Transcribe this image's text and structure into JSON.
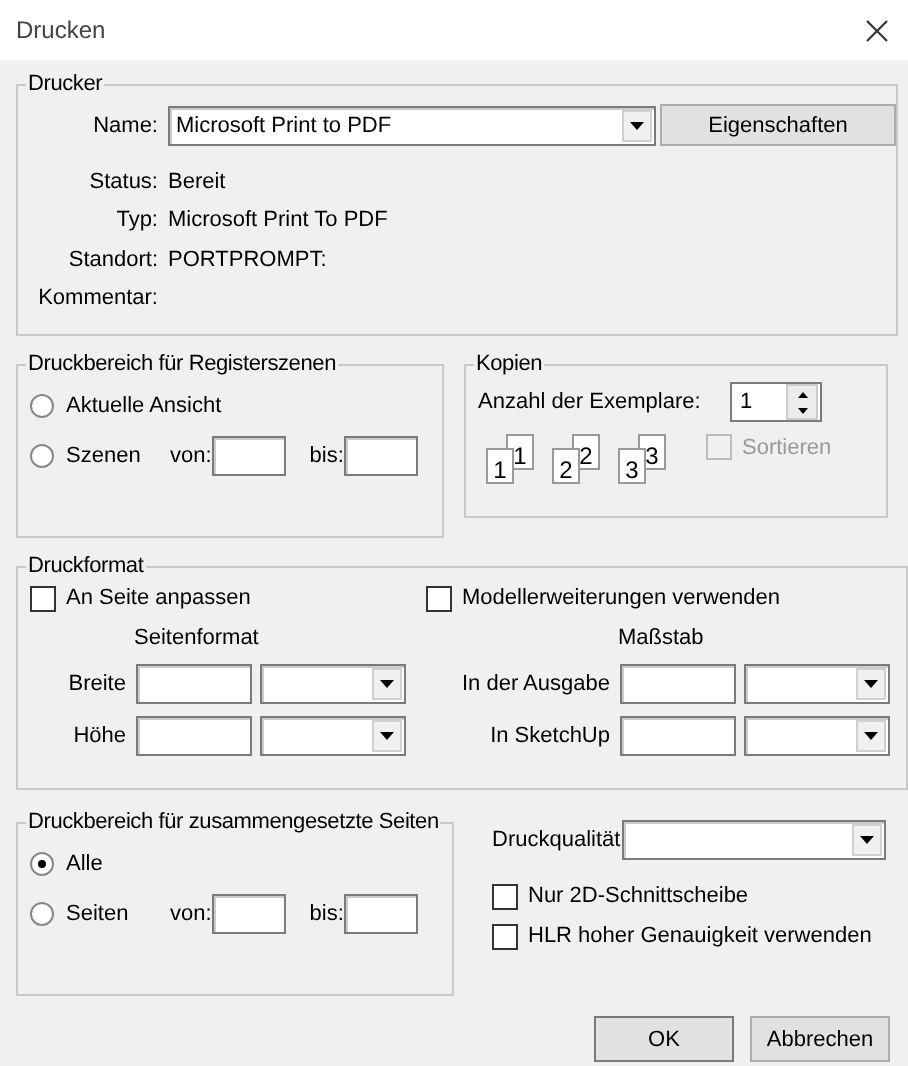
{
  "window": {
    "title": "Drucken"
  },
  "printer": {
    "title": "Drucker",
    "name_label": "Name:",
    "name_value": "Microsoft Print to PDF",
    "properties_button": "Eigenschaften",
    "details": [
      {
        "label": "Status:",
        "value": "Bereit"
      },
      {
        "label": "Typ:",
        "value": "Microsoft Print To PDF"
      },
      {
        "label": "Standort:",
        "value": "PORTPROMPT:"
      },
      {
        "label": "Kommentar:"
      }
    ]
  },
  "scene_range": {
    "title": "Druckbereich für Registerszenen",
    "options": [
      {
        "label": "Aktuelle Ansicht",
        "selected": false
      },
      {
        "label": "Szenen",
        "selected": false
      }
    ],
    "from_label": "von:",
    "to_label": "bis:"
  },
  "copies": {
    "title": "Kopien",
    "count_label": "Anzahl der Exemplare:",
    "count": "1",
    "collate": {
      "label": "Sortieren",
      "checked": false,
      "disabled": true
    },
    "pages": [
      {
        "back": "1",
        "front": "1"
      },
      {
        "back": "2",
        "front": "2"
      },
      {
        "back": "3",
        "front": "3"
      }
    ]
  },
  "format": {
    "title": "Druckformat",
    "fit_to_page": {
      "label": "An Seite anpassen",
      "checked": false
    },
    "model_extensions": {
      "label": "Modellerweiterungen verwenden",
      "checked": false
    },
    "page_size": {
      "title": "Seitenformat",
      "rows": [
        {
          "label": "Breite"
        },
        {
          "label": "Höhe"
        }
      ]
    },
    "scale": {
      "title": "Maßstab",
      "rows": [
        {
          "label": "In der Ausgabe"
        },
        {
          "label": "In SketchUp"
        }
      ]
    }
  },
  "page_range": {
    "title": "Druckbereich für zusammengesetzte Seiten",
    "options": [
      {
        "label": "Alle",
        "selected": true
      },
      {
        "label": "Seiten",
        "selected": false
      }
    ],
    "from_label": "von:",
    "to_label": "bis:"
  },
  "quality": {
    "label": "Druckqualität"
  },
  "options": [
    {
      "label": "Nur 2D-Schnittscheibe",
      "checked": false
    },
    {
      "label": "HLR hoher Genauigkeit verwenden",
      "checked": false
    }
  ],
  "buttons": [
    "OK",
    "Abbrechen"
  ]
}
